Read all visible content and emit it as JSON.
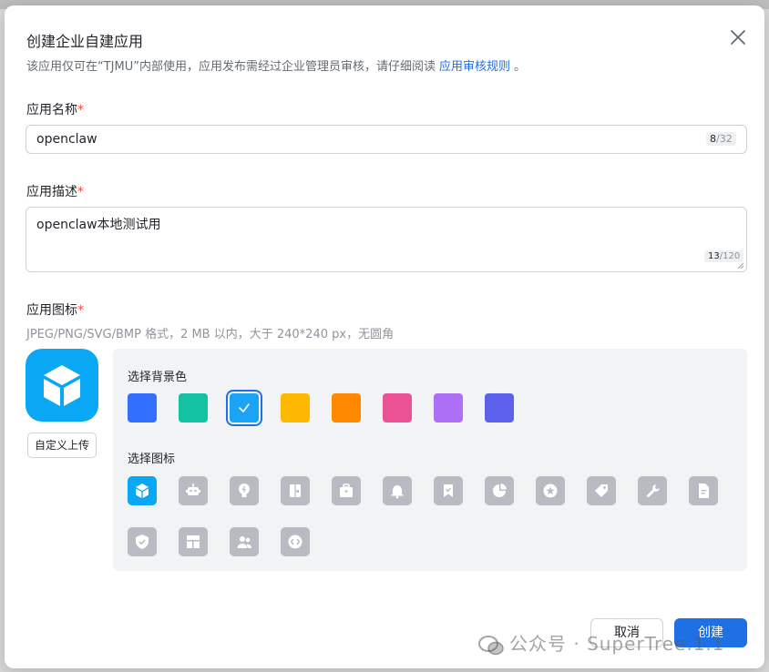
{
  "dialog": {
    "title": "创建企业自建应用",
    "subtitle_text": "该应用仅可在“TJMU”内部使用，应用发布需经过企业管理员审核，请仔细阅读",
    "subtitle_link": "应用审核规则",
    "subtitle_end": "。"
  },
  "name_field": {
    "label": "应用名称",
    "required_mark": "*",
    "value": "openclaw",
    "count_current": "8",
    "count_max": "/32"
  },
  "desc_field": {
    "label": "应用描述",
    "required_mark": "*",
    "value": "openclaw本地测试用",
    "count_current": "13",
    "count_max": "/120"
  },
  "icon_field": {
    "label": "应用图标",
    "required_mark": "*",
    "hint": "JPEG/PNG/SVG/BMP 格式，2 MB 以内，大于 240*240 px，无圆角",
    "upload_label": "自定义上传",
    "bg_section_label": "选择背景色",
    "icon_section_label": "选择图标",
    "bg_colors": [
      "#3370ff",
      "#13c2a3",
      "#1ba4f5",
      "#ffb800",
      "#ff8800",
      "#ea5393",
      "#ad6ff6",
      "#5b61ea"
    ],
    "selected_bg_index": 2,
    "icons": [
      "cube-icon",
      "robot-icon",
      "lightbulb-icon",
      "document-split-icon",
      "briefcase-icon",
      "bell-icon",
      "bookmark-check-icon",
      "pie-chart-icon",
      "star-badge-icon",
      "tag-icon",
      "wrench-icon",
      "file-text-icon",
      "shield-check-icon",
      "layout-icon",
      "people-icon",
      "code-icon"
    ],
    "selected_icon_index": 0
  },
  "footer": {
    "cancel_label": "取消",
    "create_label": "创建"
  },
  "watermark": {
    "text": "公众号 · SuperTree.1.1"
  },
  "colors": {
    "accent": "#1f6fe5",
    "icon_active": "#0aa7f5",
    "icon_inactive": "#b8bcc2",
    "required": "#f54a45"
  }
}
